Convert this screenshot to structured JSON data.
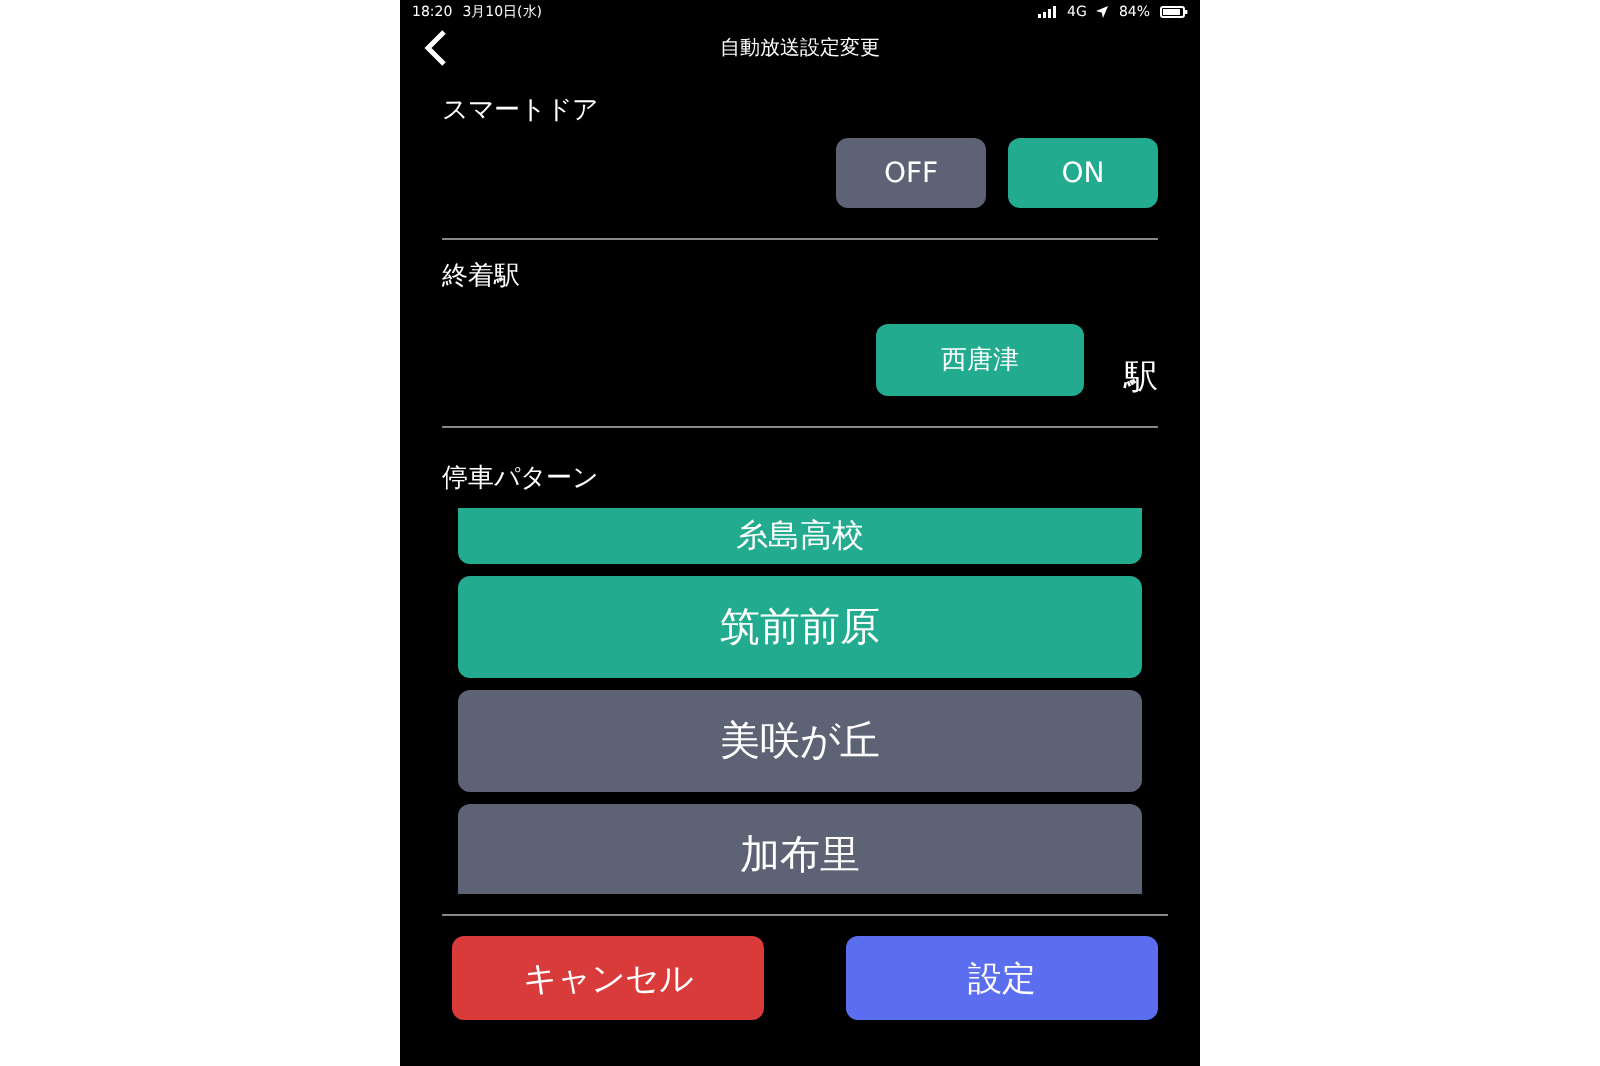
{
  "status_bar": {
    "time": "18:20",
    "date": "3月10日(水)",
    "network": "4G",
    "battery": "84%"
  },
  "header": {
    "title": "自動放送設定変更"
  },
  "smart_door": {
    "label": "スマートドア",
    "options": [
      {
        "label": "OFF",
        "selected": false
      },
      {
        "label": "ON",
        "selected": true
      }
    ]
  },
  "terminal": {
    "label": "終着駅",
    "value": "西唐津",
    "suffix": "駅"
  },
  "stop_pattern": {
    "label": "停車パターン",
    "stops": [
      {
        "name": "糸島高校",
        "selected": true
      },
      {
        "name": "筑前前原",
        "selected": true
      },
      {
        "name": "美咲が丘",
        "selected": false
      },
      {
        "name": "加布里",
        "selected": false
      }
    ]
  },
  "buttons": [
    {
      "label": "キャンセル",
      "kind": "cancel"
    },
    {
      "label": "設定",
      "kind": "confirm"
    }
  ]
}
